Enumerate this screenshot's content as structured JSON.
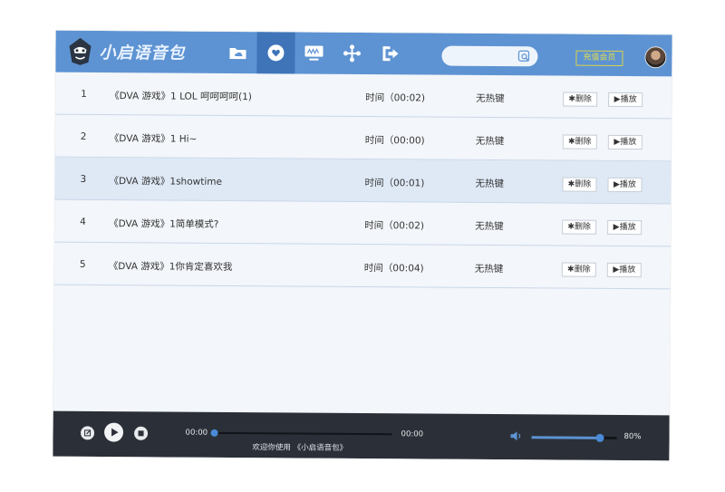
{
  "app": {
    "title": "小启语音包",
    "vip_label": "充值会员",
    "search": {
      "placeholder": ""
    }
  },
  "nav": [
    {
      "icon": "folder-cloud-icon",
      "active": false
    },
    {
      "icon": "heart-icon",
      "active": true
    },
    {
      "icon": "monitor-icon",
      "active": false
    },
    {
      "icon": "move-arrows-icon",
      "active": false
    },
    {
      "icon": "exit-icon",
      "active": false
    }
  ],
  "tracks": [
    {
      "index": "1",
      "title": "《DVA 游戏》1 LOL 呵呵呵呵(1)",
      "time": "时间（00:02)",
      "hotkey": "无热键",
      "delete_label": "删除",
      "play_label": "播放",
      "selected": false
    },
    {
      "index": "2",
      "title": "《DVA 游戏》1 Hi~",
      "time": "时间（00:00)",
      "hotkey": "无热键",
      "delete_label": "删除",
      "play_label": "播放",
      "selected": false
    },
    {
      "index": "3",
      "title": "《DVA 游戏》1showtime",
      "time": "时间（00:01)",
      "hotkey": "无热键",
      "delete_label": "删除",
      "play_label": "播放",
      "selected": true
    },
    {
      "index": "4",
      "title": "《DVA 游戏》1简单模式?",
      "time": "时间（00:02)",
      "hotkey": "无热键",
      "delete_label": "删除",
      "play_label": "播放",
      "selected": false
    },
    {
      "index": "5",
      "title": "《DVA 游戏》1你肯定喜欢我",
      "time": "时间（00:04)",
      "hotkey": "无热键",
      "delete_label": "删除",
      "play_label": "播放",
      "selected": false
    }
  ],
  "player": {
    "current_time": "00:00",
    "total_time": "00:00",
    "progress": 0,
    "welcome_text": "欢迎你使用 《小启语音包》",
    "volume": 0.8,
    "volume_label": "80%"
  },
  "colors": {
    "topbar": "#5d93d3",
    "nav_active": "#3f74b8",
    "selected_row": "#dfe9f6",
    "player_bg": "#2b3038",
    "accent": "#5d93d3",
    "vip": "#e3dc4c"
  }
}
